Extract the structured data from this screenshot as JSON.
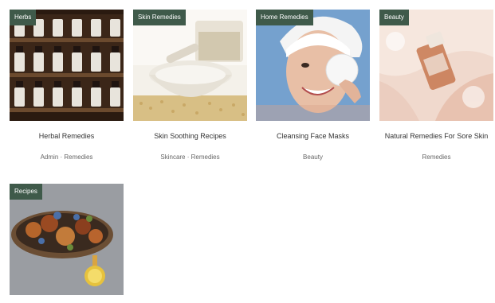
{
  "posts": [
    {
      "category": "Herbs",
      "title": "Herbal Remedies",
      "meta": "Admin · Remedies",
      "image": "apothecary-shelves-image"
    },
    {
      "category": "Skin Remedies",
      "title": "Skin Soothing Recipes",
      "meta": "Skincare · Remedies",
      "image": "mortar-pestle-image"
    },
    {
      "category": "Home Remedies",
      "title": "Cleansing Face Masks",
      "meta": "Beauty",
      "image": "woman-cotton-pad-image"
    },
    {
      "category": "Beauty",
      "title": "Natural Remedies For Sore Skin",
      "meta": "Remedies",
      "image": "essential-oil-bottle-image"
    },
    {
      "category": "Recipes",
      "image": "food-platter-lemon-image"
    }
  ]
}
